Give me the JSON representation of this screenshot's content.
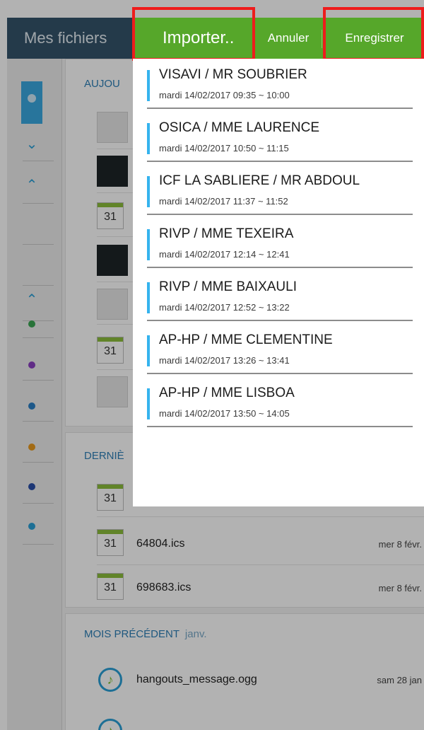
{
  "app": {
    "title": "Mes fichiers",
    "sections": [
      {
        "heading": "AUJOURD'HUI",
        "heading_visible": "AUJOU"
      },
      {
        "heading_visible": "DERNIÈ"
      },
      {
        "heading": "MOIS PRÉCÉDENT",
        "subheading": "janv."
      }
    ],
    "files": [
      {
        "name": "64804.ics",
        "date": "mer 8 févr."
      },
      {
        "name": "698683.ics",
        "date": "mer 8 févr."
      },
      {
        "name": "hangouts_message.ogg",
        "date": "sam 28 jan"
      }
    ],
    "calendar_day": "31"
  },
  "toolbar": {
    "import_label": "Importer..",
    "cancel_label": "Annuler",
    "save_label": "Enregistrer"
  },
  "events": [
    {
      "title": "VISAVI / MR SOUBRIER",
      "time": "mardi 14/02/2017 09:35 ~ 10:00"
    },
    {
      "title": "OSICA / MME LAURENCE",
      "time": "mardi 14/02/2017 10:50 ~ 11:15"
    },
    {
      "title": "ICF LA SABLIERE / MR ABDOUL",
      "time": "mardi 14/02/2017 11:37 ~ 11:52"
    },
    {
      "title": "RIVP / MME TEXEIRA",
      "time": "mardi 14/02/2017 12:14 ~ 12:41"
    },
    {
      "title": "RIVP / MME BAIXAULI",
      "time": "mardi 14/02/2017 12:52 ~ 13:22"
    },
    {
      "title": "AP-HP / MME CLEMENTINE",
      "time": "mardi 14/02/2017 13:26 ~ 13:41"
    },
    {
      "title": "AP-HP / MME LISBOA",
      "time": "mardi 14/02/2017 13:50 ~ 14:05"
    }
  ],
  "colors": {
    "topbar": "#34536b",
    "actionbar": "#56a72a",
    "event_accent": "#35b3ee",
    "highlight": "#ee1c1c"
  }
}
